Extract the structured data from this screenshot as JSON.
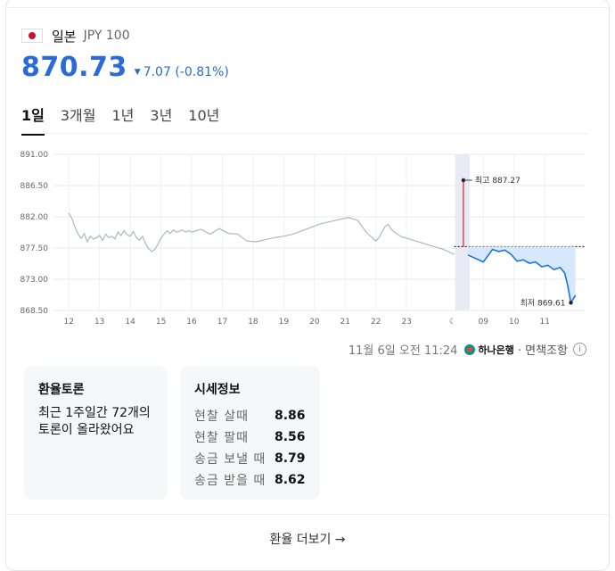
{
  "header": {
    "country_name": "일본",
    "currency_code": "JPY 100",
    "rate": "870.73",
    "change": "7.07 (-0.81%)",
    "change_arrow": "▼"
  },
  "tabs": [
    {
      "label": "1일",
      "active": true
    },
    {
      "label": "3개월",
      "active": false
    },
    {
      "label": "1년",
      "active": false
    },
    {
      "label": "3년",
      "active": false
    },
    {
      "label": "10년",
      "active": false
    }
  ],
  "chart_data": {
    "type": "line",
    "y_ticks": [
      "891.00",
      "886.50",
      "882.00",
      "877.50",
      "873.00",
      "868.50"
    ],
    "ylim": [
      868.5,
      891.0
    ],
    "x_ticks": [
      "12",
      "13",
      "14",
      "15",
      "16",
      "17",
      "18",
      "19",
      "20",
      "21",
      "22",
      "23",
      "09",
      "10",
      "11"
    ],
    "night_marker": "☾",
    "grid": true,
    "annotations": {
      "high_label": "최고 887.27",
      "high_value": 887.27,
      "low_label": "최저 869.61",
      "low_value": 869.61,
      "reference_value": 877.7
    },
    "series": [
      {
        "style": "previous",
        "color": "#b0b4c8",
        "x": [
          0.0,
          0.1,
          0.2,
          0.3,
          0.4,
          0.5,
          0.6,
          0.7,
          0.8,
          0.9,
          1.0,
          1.1,
          1.2,
          1.3,
          1.4,
          1.5,
          1.6,
          1.7,
          1.8,
          1.9,
          2.0,
          2.1,
          2.2,
          2.3,
          2.4,
          2.5,
          2.6,
          2.7,
          2.8,
          2.9,
          3.0,
          3.1,
          3.2,
          3.3,
          3.4,
          3.5,
          3.6,
          3.7,
          3.8,
          3.9,
          4.0,
          4.3,
          4.6,
          4.9,
          5.2,
          5.5,
          5.8,
          6.1,
          6.4,
          6.7,
          7.0,
          7.3,
          7.6,
          7.9,
          8.2,
          8.5,
          8.8,
          9.1,
          9.4,
          9.7,
          10.0,
          10.1,
          10.2,
          10.3,
          10.4,
          10.5,
          10.6,
          10.7,
          10.8,
          11.0,
          11.3,
          11.6,
          11.9,
          12.2,
          12.55
        ],
        "y": [
          882.5,
          881.8,
          880.5,
          879.5,
          878.9,
          879.6,
          878.4,
          879.2,
          878.8,
          879.0,
          879.3,
          878.6,
          879.5,
          879.0,
          879.2,
          878.8,
          879.8,
          879.3,
          880.0,
          879.4,
          879.2,
          879.9,
          879.0,
          878.6,
          879.2,
          878.1,
          877.4,
          877.0,
          877.3,
          878.0,
          878.9,
          879.5,
          880.0,
          879.6,
          880.1,
          879.8,
          879.9,
          880.1,
          879.8,
          880.0,
          879.8,
          880.2,
          879.5,
          880.3,
          879.6,
          879.5,
          878.5,
          878.4,
          878.7,
          879.0,
          879.2,
          879.5,
          880.0,
          880.5,
          881.0,
          881.3,
          881.6,
          881.9,
          881.5,
          879.7,
          878.5,
          879.0,
          879.8,
          880.6,
          880.9,
          880.2,
          879.8,
          879.5,
          879.2,
          878.9,
          878.5,
          878.1,
          877.7,
          877.3,
          876.6
        ]
      },
      {
        "style": "today",
        "color": "#1a73e8",
        "x": [
          13.0,
          13.5,
          13.8,
          14.0,
          14.2,
          14.4,
          14.6,
          14.8,
          15.0,
          15.2,
          15.4,
          15.6,
          15.8,
          16.0,
          16.15,
          16.25,
          16.35,
          16.5
        ],
        "y": [
          876.5,
          875.5,
          877.3,
          877.0,
          877.2,
          876.6,
          875.6,
          875.8,
          875.3,
          875.5,
          874.8,
          875.0,
          874.4,
          874.7,
          873.9,
          872.0,
          869.6,
          870.7
        ]
      }
    ]
  },
  "update_info": {
    "timestamp": "11월 6일 오전 11:24",
    "bank_name": "하나은행",
    "note": "· 면책조항",
    "info_icon": "ⓘ"
  },
  "discussion": {
    "title": "환율토론",
    "body": "최근 1주일간 72개의 토론이 올라왔어요"
  },
  "market_info": {
    "title": "시세정보",
    "rows": [
      {
        "label": "현찰 살때",
        "value": "8.86"
      },
      {
        "label": "현찰 팔때",
        "value": "8.56"
      },
      {
        "label": "송금 보낼 때",
        "value": "8.79"
      },
      {
        "label": "송금 받을 때",
        "value": "8.62"
      }
    ]
  },
  "footer": {
    "more_label": "환율 더보기 →"
  }
}
